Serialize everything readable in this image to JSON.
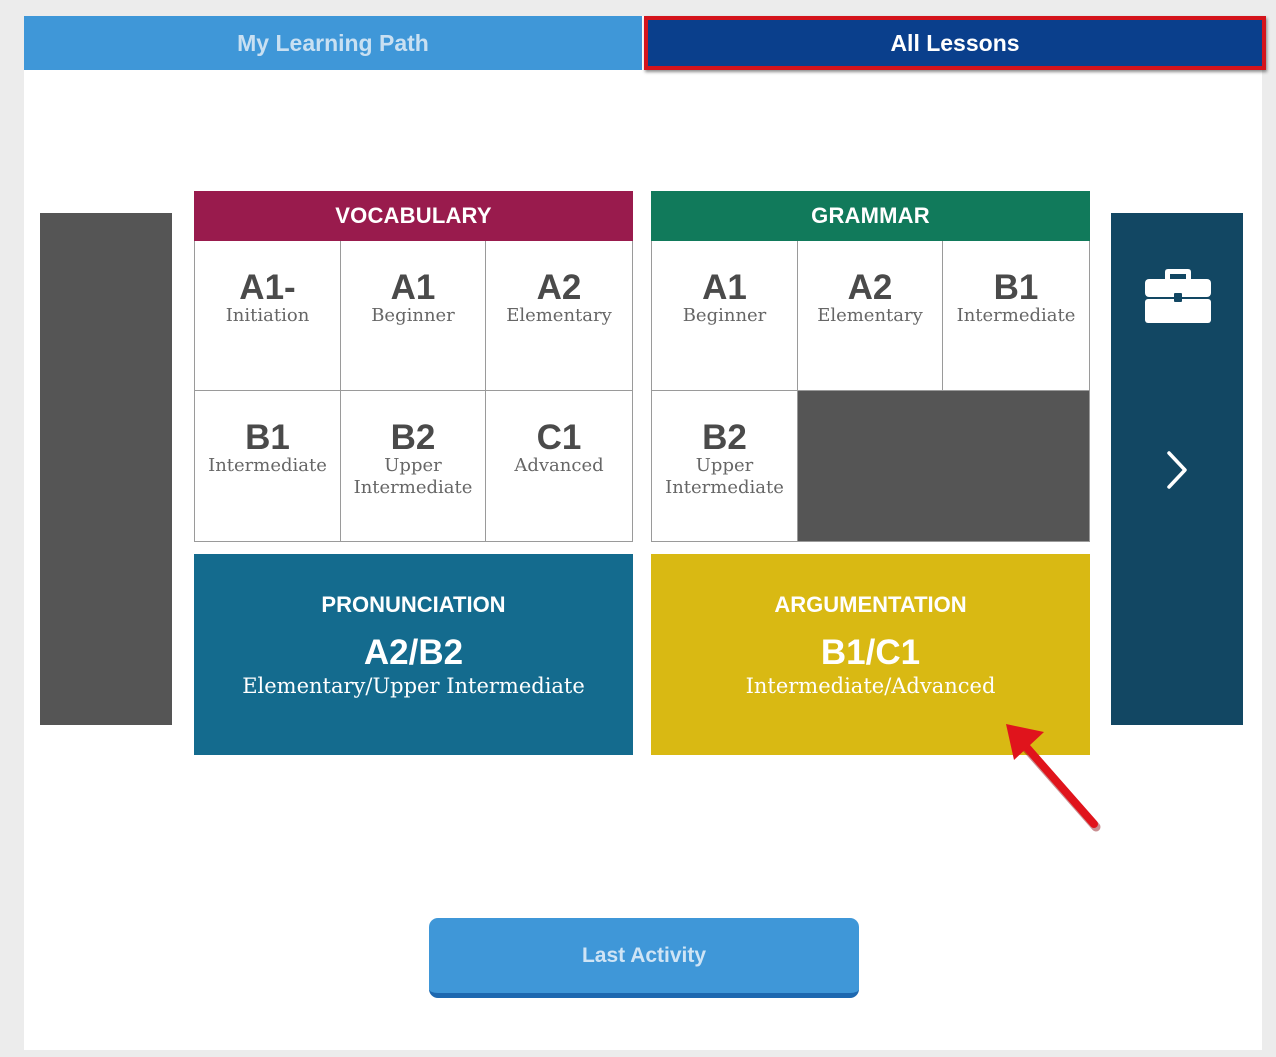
{
  "tabs": {
    "learning_path": "My Learning Path",
    "all_lessons": "All Lessons"
  },
  "vocabulary": {
    "title": "VOCABULARY",
    "levels": [
      {
        "code": "A1-",
        "desc": "Initiation"
      },
      {
        "code": "A1",
        "desc": "Beginner"
      },
      {
        "code": "A2",
        "desc": "Elementary"
      },
      {
        "code": "B1",
        "desc": "Intermediate"
      },
      {
        "code": "B2",
        "desc": "Upper Intermediate"
      },
      {
        "code": "C1",
        "desc": "Advanced"
      }
    ]
  },
  "grammar": {
    "title": "GRAMMAR",
    "levels": [
      {
        "code": "A1",
        "desc": "Beginner"
      },
      {
        "code": "A2",
        "desc": "Elementary"
      },
      {
        "code": "B1",
        "desc": "Intermediate"
      },
      {
        "code": "B2",
        "desc": "Upper Intermediate"
      }
    ]
  },
  "pronunciation": {
    "title": "PRONUNCIATION",
    "level": "A2/B2",
    "desc": "Elementary/Upper Intermediate"
  },
  "argumentation": {
    "title": "ARGUMENTATION",
    "level": "B1/C1",
    "desc": "Intermediate/Advanced"
  },
  "last_activity": "Last Activity",
  "icons": {
    "right_panel_top": "briefcase-icon",
    "right_panel_nav": "chevron-right-icon",
    "annotation": "red-arrow"
  },
  "colors": {
    "tab_active": "#0a3f8c",
    "tab_inactive": "#3f97d8",
    "highlight_border": "#d4141c",
    "vocabulary": "#991b4d",
    "grammar": "#117a5b",
    "pronunciation": "#146b8e",
    "argumentation": "#d9b913"
  }
}
